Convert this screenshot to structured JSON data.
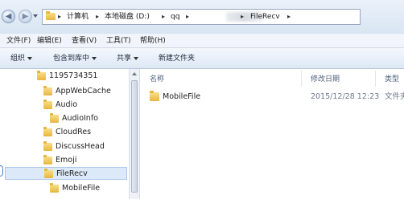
{
  "address": {
    "crumbs": [
      "计算机",
      "本地磁盘 (D:)",
      "qq",
      "FileRecv"
    ],
    "separator": "▸"
  },
  "menu": [
    "文件(F)",
    "编辑(E)",
    "查看(V)",
    "工具(T)",
    "帮助(H)"
  ],
  "toolbar": {
    "organize": "组织",
    "include_in_library": "包含到库中",
    "share": "共享",
    "new_folder": "新建文件夹"
  },
  "nav_tree": [
    {
      "label": "1195734351"
    },
    {
      "label": "AppWebCache"
    },
    {
      "label": "Audio"
    },
    {
      "label": "AudioInfo"
    },
    {
      "label": "CloudRes"
    },
    {
      "label": "DiscussHead"
    },
    {
      "label": "Emoji"
    },
    {
      "label": "FileRecv",
      "selected": true
    },
    {
      "label": "MobileFile"
    }
  ],
  "columns": {
    "name": "名称",
    "modified": "修改日期",
    "type": "类型"
  },
  "files": [
    {
      "name": "MobileFile",
      "modified": "2015/12/28 12:23",
      "type": "文件夹"
    }
  ],
  "colors": {
    "selection": "#dce9f8",
    "folder": "#e8b53c",
    "header_text": "#4c607a"
  }
}
